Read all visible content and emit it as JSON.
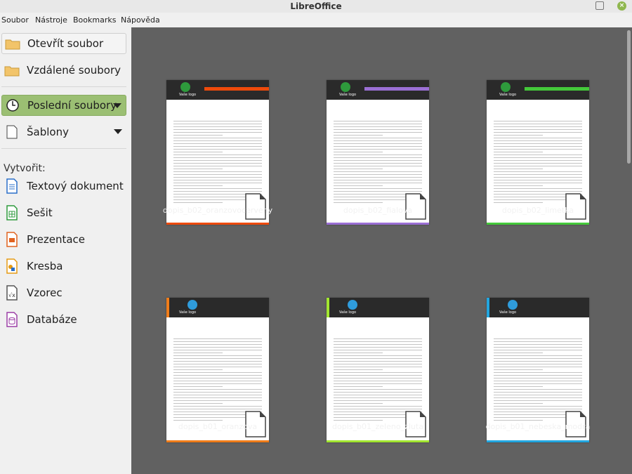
{
  "window": {
    "title": "LibreOffice"
  },
  "menu": {
    "items": [
      "Soubor",
      "Nástroje",
      "Bookmarks",
      "Nápověda"
    ]
  },
  "sidebar": {
    "open_file": "Otevřít soubor",
    "remote_files": "Vzdálené soubory",
    "recent_files": "Poslední soubory",
    "templates": "Šablony",
    "create_label": "Vytvořit:",
    "create_items": [
      "Textový dokument",
      "Sešit",
      "Prezentace",
      "Kresba",
      "Vzorec",
      "Databáze"
    ]
  },
  "templates": [
    {
      "name": "dopis_b02_oranzovocerveny",
      "accent": "#ee4a0b"
    },
    {
      "name": "dopis_b02_fialova",
      "accent": "#9b6fd5"
    },
    {
      "name": "dopis_b02_limetka",
      "accent": "#44c93a"
    },
    {
      "name": "dopis_b01_oranzova",
      "accent": "#f07d1a"
    },
    {
      "name": "dopis_b01_zeleno_zluta",
      "accent": "#a2e630"
    },
    {
      "name": "dopis_b01_nebeska_modra",
      "accent": "#22a6e0"
    }
  ],
  "thumb_texts": {
    "logo_text": "Vaše logo"
  },
  "colors": {
    "main_bg": "#616161",
    "sidebar_active": "#9bbf73"
  }
}
